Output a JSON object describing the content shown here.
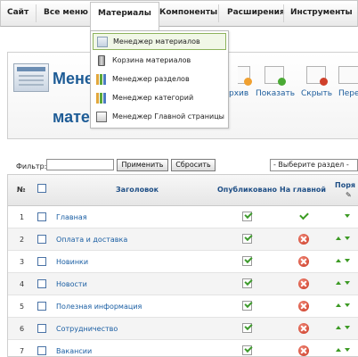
{
  "menu": {
    "items": [
      "Сайт",
      "Все меню",
      "Материалы",
      "Компоненты",
      "Расширения",
      "Инструменты"
    ],
    "active": "Материалы",
    "dropdown": [
      {
        "label": "Менеджер материалов",
        "icon": "article-manager-icon",
        "highlighted": true
      },
      {
        "label": "Корзина материалов",
        "icon": "trash-icon",
        "highlighted": false
      },
      {
        "label": "Менеджер разделов",
        "icon": "sections-icon",
        "highlighted": false
      },
      {
        "label": "Менеджер категорий",
        "icon": "categories-icon",
        "highlighted": false
      },
      {
        "label": "Менеджер Главной страницы",
        "icon": "frontpage-icon",
        "highlighted": false
      }
    ]
  },
  "header": {
    "title_line1": "Менеджер",
    "title_line1_visible": "Мене",
    "title_line2_visible": "матер"
  },
  "toolbar": {
    "buttons": [
      {
        "label": "Архив",
        "label_visible": "рхив",
        "icon": "archive-icon"
      },
      {
        "label": "Показать",
        "icon": "publish-icon"
      },
      {
        "label": "Скрыть",
        "icon": "unpublish-icon"
      },
      {
        "label": "Переместить",
        "label_visible": "Пере",
        "icon": "move-icon"
      }
    ]
  },
  "filter": {
    "label": "Фильтр:",
    "value": "",
    "apply_button": "Применить",
    "reset_button": "Сбросить",
    "section_select": "- Выберите раздел -"
  },
  "table": {
    "columns": [
      "№",
      "",
      "Заголовок",
      "Опубликовано",
      "На главной",
      "Поря"
    ],
    "rows": [
      {
        "num": "1",
        "title": "Главная",
        "published": true,
        "frontpage": true
      },
      {
        "num": "2",
        "title": "Оплата и доставка",
        "published": true,
        "frontpage": false
      },
      {
        "num": "3",
        "title": "Новинки",
        "published": true,
        "frontpage": false
      },
      {
        "num": "4",
        "title": "Новости",
        "published": true,
        "frontpage": false
      },
      {
        "num": "5",
        "title": "Полезная информация",
        "published": true,
        "frontpage": false
      },
      {
        "num": "6",
        "title": "Сотрудничество",
        "published": true,
        "frontpage": false
      },
      {
        "num": "7",
        "title": "Вакансии",
        "published": true,
        "frontpage": false
      }
    ]
  },
  "colors": {
    "link": "#1a5ea3",
    "title": "#1e5c96",
    "published_green": "#3f9b2e",
    "not_frontpage_red": "#c8331d",
    "order_arrow_green": "#3c9a24"
  }
}
